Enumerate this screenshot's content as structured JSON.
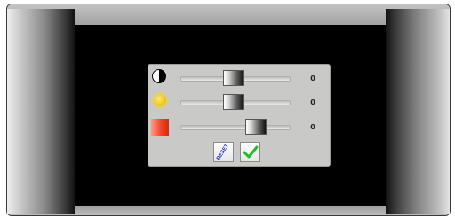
{
  "dialog": {
    "sliders": [
      {
        "id": "contrast",
        "icon": "contrast-icon",
        "value": "0"
      },
      {
        "id": "brightness",
        "icon": "brightness-icon",
        "value": "0"
      },
      {
        "id": "color",
        "icon": "color-saturation-icon",
        "value": "0"
      }
    ],
    "reset_label": "RESET",
    "confirm_icon": "checkmark-icon"
  },
  "colors": {
    "screen": "#000000",
    "panel": "#c9c9c7",
    "reset_text": "#1f2fd0",
    "check": "#1fbf2a",
    "color_swatch": "#f04020",
    "brightness_sun": "#f2c200"
  }
}
